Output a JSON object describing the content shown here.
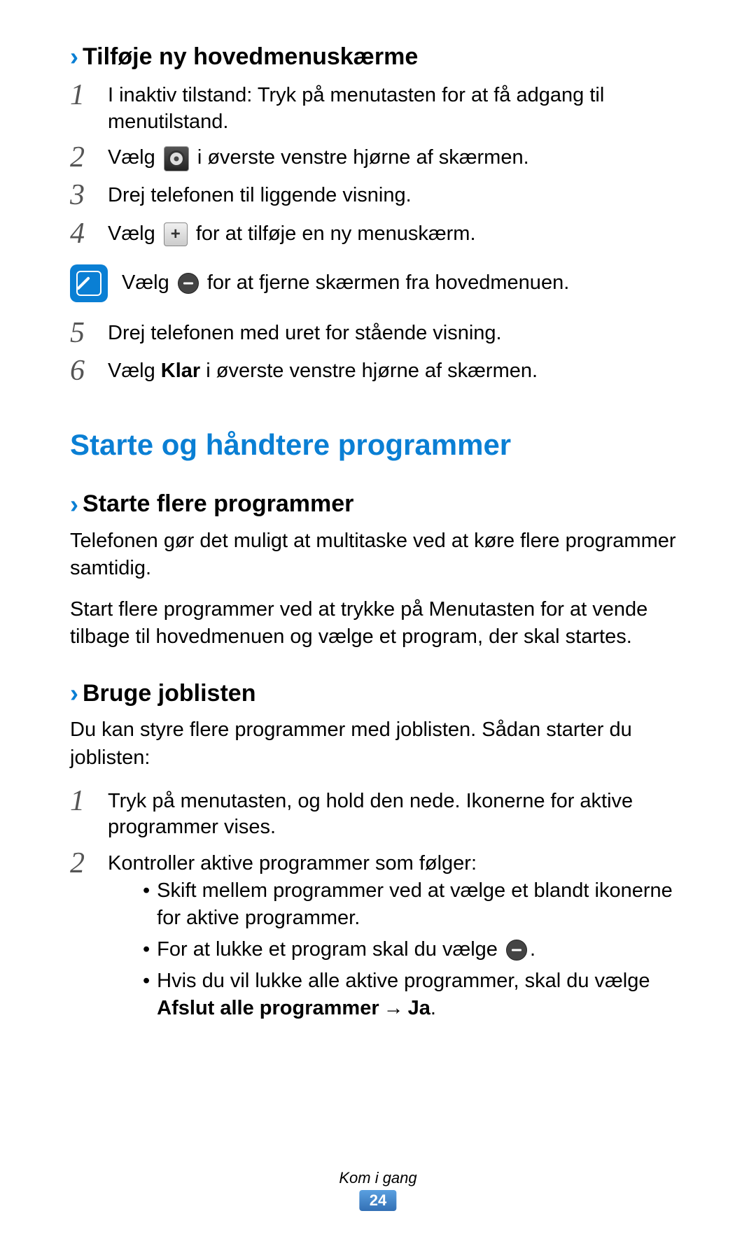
{
  "headings": {
    "h1": "Tilføje ny hovedmenuskærme",
    "main": "Starte og håndtere programmer",
    "h2": "Starte flere programmer",
    "h3": "Bruge joblisten"
  },
  "steps_section1": {
    "s1": "I inaktiv tilstand: Tryk på menutasten for at få adgang til menutilstand.",
    "s2_pre": "Vælg",
    "s2_post": "i øverste venstre hjørne af skærmen.",
    "s3": "Drej telefonen til liggende visning.",
    "s4_pre": "Vælg",
    "s4_post": "for at tilføje en ny menuskærm.",
    "note_pre": "Vælg",
    "note_post": "for at fjerne skærmen fra hovedmenuen.",
    "s5": "Drej telefonen med uret for stående visning.",
    "s6_pre": "Vælg ",
    "s6_bold": "Klar",
    "s6_post": " i øverste venstre hjørne af skærmen."
  },
  "section2": {
    "p1": "Telefonen gør det muligt at multitaske ved at køre flere programmer samtidig.",
    "p2": "Start flere programmer ved at trykke på Menutasten for at vende tilbage til hovedmenuen og vælge et program, der skal startes."
  },
  "section3": {
    "intro": "Du kan styre flere programmer med joblisten. Sådan starter du joblisten:",
    "s1": "Tryk på menutasten, og hold den nede. Ikonerne for aktive programmer vises.",
    "s2": "Kontroller aktive programmer som følger:",
    "b1": "Skift mellem programmer ved at vælge et blandt ikonerne for aktive programmer.",
    "b2_pre": "For at lukke et program skal du vælge",
    "b2_post": ".",
    "b3_pre": "Hvis du vil lukke alle aktive programmer, skal du vælge ",
    "b3_bold": "Afslut alle programmer",
    "b3_arrow": "→",
    "b3_bold2": "Ja",
    "b3_post": "."
  },
  "footer": {
    "chapter": "Kom i gang",
    "page": "24"
  },
  "nums": {
    "n1": "1",
    "n2": "2",
    "n3": "3",
    "n4": "4",
    "n5": "5",
    "n6": "6"
  }
}
